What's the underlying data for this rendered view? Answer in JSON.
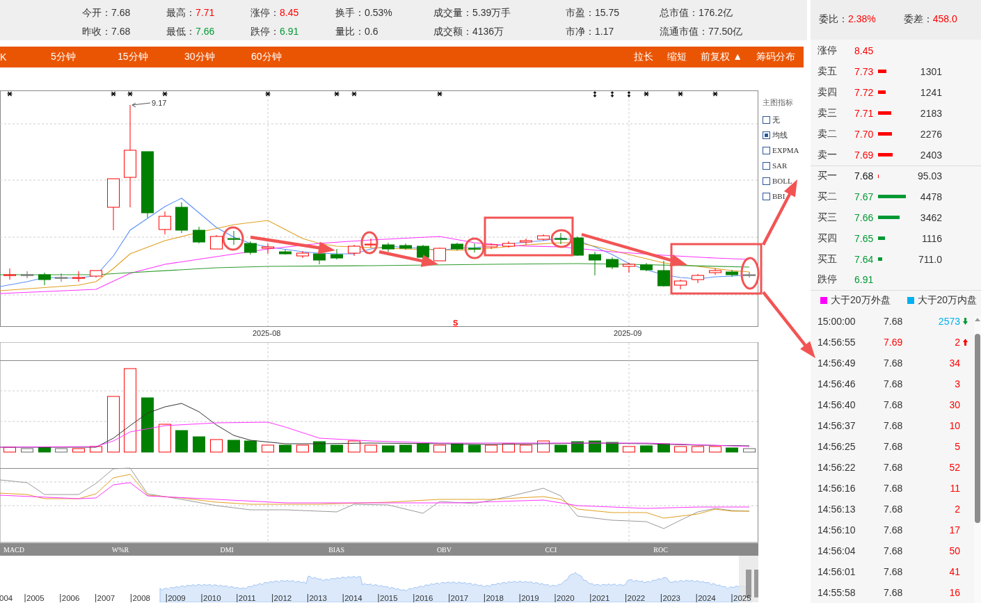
{
  "quote_stats": [
    [
      {
        "label": "今开：",
        "value": "7.68",
        "color": "#333333"
      },
      {
        "label": "最高：",
        "value": "7.71",
        "color": "#ff0000"
      },
      {
        "label": "涨停：",
        "value": "8.45",
        "color": "#ff0000"
      },
      {
        "label": "换手：",
        "value": "0.53%",
        "color": "#333333"
      },
      {
        "label": "成交量：",
        "value": "5.39万手",
        "color": "#333333"
      },
      {
        "label": "市盈：",
        "value": "15.75",
        "color": "#333333"
      },
      {
        "label": "总市值：",
        "value": "176.2亿",
        "color": "#333333"
      }
    ],
    [
      {
        "label": "昨收：",
        "value": "7.68",
        "color": "#333333"
      },
      {
        "label": "最低：",
        "value": "7.66",
        "color": "#009933"
      },
      {
        "label": "跌停：",
        "value": "6.91",
        "color": "#009933"
      },
      {
        "label": "量比：",
        "value": "0.6",
        "color": "#333333"
      },
      {
        "label": "成交额：",
        "value": "4136万",
        "color": "#333333"
      },
      {
        "label": "市净：",
        "value": "1.17",
        "color": "#333333"
      },
      {
        "label": "流通市值：",
        "value": "77.50亿",
        "color": "#333333"
      }
    ]
  ],
  "period_tabs": [
    "K",
    "5分钟",
    "15分钟",
    "30分钟",
    "60分钟"
  ],
  "chart_tools": [
    "拉长",
    "缩短",
    "前复权 ▲",
    "筹码分布"
  ],
  "main_chart": {
    "peak_label": "9.17",
    "signal_marker": "S",
    "date_labels": [
      "2025-08",
      "2025-09"
    ]
  },
  "indicator_legend": {
    "title": "主图指标",
    "options": [
      {
        "label": "无",
        "checked": false
      },
      {
        "label": "均线",
        "checked": true
      },
      {
        "label": "EXPMA",
        "checked": false
      },
      {
        "label": "SAR",
        "checked": false
      },
      {
        "label": "BOLL",
        "checked": false
      },
      {
        "label": "BBI",
        "checked": false
      }
    ]
  },
  "indicator_tabs": [
    "MACD",
    "W%R",
    "DMI",
    "BIAS",
    "OBV",
    "CCI",
    "ROC"
  ],
  "timeline_years": [
    "004",
    "2005",
    "2006",
    "2007",
    "2008",
    "2009",
    "2010",
    "2011",
    "2012",
    "2013",
    "2014",
    "2015",
    "2016",
    "2017",
    "2018",
    "2019",
    "2020",
    "2021",
    "2022",
    "2023",
    "2024",
    "2025"
  ],
  "order_summary": [
    {
      "label": "委比：",
      "value": "2.38%"
    },
    {
      "label": "委差：",
      "value": "458.0"
    }
  ],
  "order_book": [
    {
      "kind": "limit",
      "label": "涨停",
      "price": {
        "text": "8.45",
        "color": "#ff0000"
      }
    },
    {
      "kind": "level",
      "label": "卖五",
      "price": {
        "text": "7.73",
        "color": "#ff0000"
      },
      "bar": {
        "color": "#ff0000"
      },
      "volume": "1301"
    },
    {
      "kind": "level",
      "label": "卖四",
      "price": {
        "text": "7.72",
        "color": "#ff0000"
      },
      "bar": {
        "color": "#ff0000"
      },
      "volume": "1241"
    },
    {
      "kind": "level",
      "label": "卖三",
      "price": {
        "text": "7.71",
        "color": "#ff0000"
      },
      "bar": {
        "color": "#ff0000"
      },
      "volume": "2183"
    },
    {
      "kind": "level",
      "label": "卖二",
      "price": {
        "text": "7.70",
        "color": "#ff0000"
      },
      "bar": {
        "color": "#ff0000"
      },
      "volume": "2276"
    },
    {
      "kind": "level",
      "label": "卖一",
      "price": {
        "text": "7.69",
        "color": "#ff0000"
      },
      "bar": {
        "color": "#ff0000"
      },
      "volume": "2403"
    },
    {
      "kind": "level",
      "label": "买一",
      "price": {
        "text": "7.68",
        "color": "#111111"
      },
      "bar": {
        "color": "#ff0000"
      },
      "volume": "95.03"
    },
    {
      "kind": "level",
      "label": "买二",
      "price": {
        "text": "7.67",
        "color": "#009933"
      },
      "bar": {
        "color": "#009933"
      },
      "volume": "4478"
    },
    {
      "kind": "level",
      "label": "买三",
      "price": {
        "text": "7.66",
        "color": "#009933"
      },
      "bar": {
        "color": "#009933"
      },
      "volume": "3462"
    },
    {
      "kind": "level",
      "label": "买四",
      "price": {
        "text": "7.65",
        "color": "#009933"
      },
      "bar": {
        "color": "#009933"
      },
      "volume": "1116"
    },
    {
      "kind": "level",
      "label": "买五",
      "price": {
        "text": "7.64",
        "color": "#009933"
      },
      "bar": {
        "color": "#009933"
      },
      "volume": "711.0"
    },
    {
      "kind": "limit",
      "label": "跌停",
      "price": {
        "text": "6.91",
        "color": "#009933"
      }
    }
  ],
  "big_order_legend": [
    {
      "label": "大于20万外盘",
      "color": "#ff00ff"
    },
    {
      "label": "大于20万内盘",
      "color": "#00b0f0"
    }
  ],
  "trades": [
    {
      "kind": "down",
      "time": "15:00:00",
      "price": {
        "text": "7.68",
        "color": "#333333"
      },
      "volume": {
        "text": "2573",
        "color": "#00b0f0"
      }
    },
    {
      "kind": "up",
      "time": "14:56:55",
      "price": {
        "text": "7.69",
        "color": "#ff0000"
      },
      "volume": {
        "text": "2",
        "color": "#ff0000"
      }
    },
    {
      "kind": "plain",
      "time": "14:56:49",
      "price": {
        "text": "7.68",
        "color": "#333333"
      },
      "volume": {
        "text": "34",
        "color": "#ff0000"
      }
    },
    {
      "kind": "plain",
      "time": "14:56:46",
      "price": {
        "text": "7.68",
        "color": "#333333"
      },
      "volume": {
        "text": "3",
        "color": "#ff0000"
      }
    },
    {
      "kind": "plain",
      "time": "14:56:40",
      "price": {
        "text": "7.68",
        "color": "#333333"
      },
      "volume": {
        "text": "30",
        "color": "#ff0000"
      }
    },
    {
      "kind": "plain",
      "time": "14:56:37",
      "price": {
        "text": "7.68",
        "color": "#333333"
      },
      "volume": {
        "text": "10",
        "color": "#ff0000"
      }
    },
    {
      "kind": "plain",
      "time": "14:56:25",
      "price": {
        "text": "7.68",
        "color": "#333333"
      },
      "volume": {
        "text": "5",
        "color": "#ff0000"
      }
    },
    {
      "kind": "plain",
      "time": "14:56:22",
      "price": {
        "text": "7.68",
        "color": "#333333"
      },
      "volume": {
        "text": "52",
        "color": "#ff0000"
      }
    },
    {
      "kind": "plain",
      "time": "14:56:16",
      "price": {
        "text": "7.68",
        "color": "#333333"
      },
      "volume": {
        "text": "11",
        "color": "#ff0000"
      }
    },
    {
      "kind": "plain",
      "time": "14:56:13",
      "price": {
        "text": "7.68",
        "color": "#333333"
      },
      "volume": {
        "text": "2",
        "color": "#ff0000"
      }
    },
    {
      "kind": "plain",
      "time": "14:56:10",
      "price": {
        "text": "7.68",
        "color": "#333333"
      },
      "volume": {
        "text": "17",
        "color": "#ff0000"
      }
    },
    {
      "kind": "plain",
      "time": "14:56:04",
      "price": {
        "text": "7.68",
        "color": "#333333"
      },
      "volume": {
        "text": "50",
        "color": "#ff0000"
      }
    },
    {
      "kind": "plain",
      "time": "14:56:01",
      "price": {
        "text": "7.68",
        "color": "#333333"
      },
      "volume": {
        "text": "41",
        "color": "#ff0000"
      }
    },
    {
      "kind": "plain",
      "time": "14:55:58",
      "price": {
        "text": "7.68",
        "color": "#333333"
      },
      "volume": {
        "text": "16",
        "color": "#ff0000"
      }
    }
  ]
}
